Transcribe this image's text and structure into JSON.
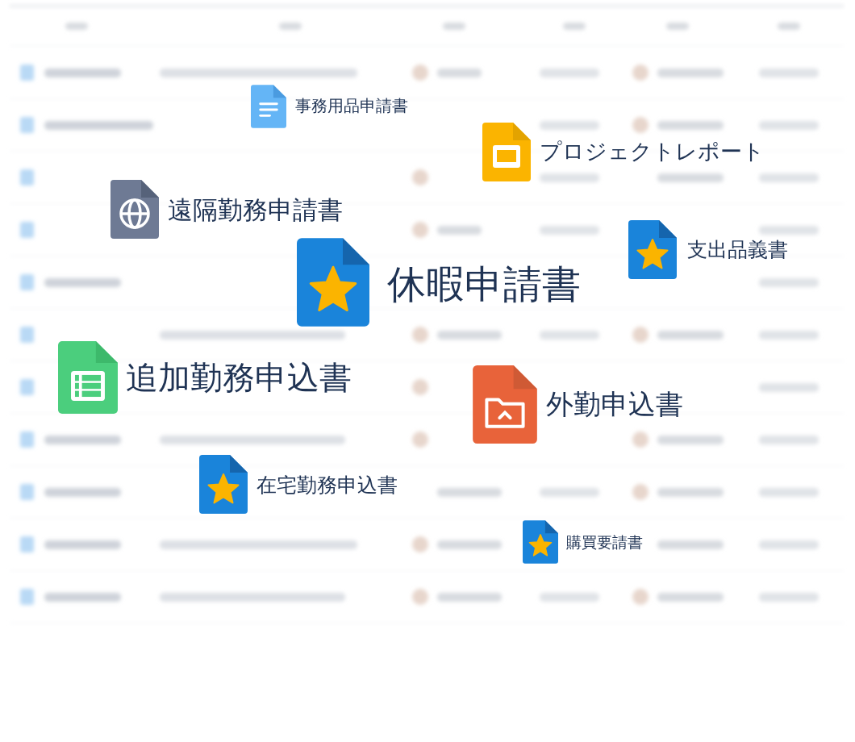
{
  "documents": [
    {
      "label": "事務用品申請書",
      "kind": "text"
    },
    {
      "label": "プロジェクトレポート",
      "kind": "slides"
    },
    {
      "label": "遠隔勤務申請書",
      "kind": "web"
    },
    {
      "label": "支出品義書",
      "kind": "star"
    },
    {
      "label": "休暇申請書",
      "kind": "star"
    },
    {
      "label": "追加勤務申込書",
      "kind": "sheet"
    },
    {
      "label": "外勤申込書",
      "kind": "folder"
    },
    {
      "label": "在宅勤務申込書",
      "kind": "star"
    },
    {
      "label": "購買要請書",
      "kind": "star"
    }
  ]
}
